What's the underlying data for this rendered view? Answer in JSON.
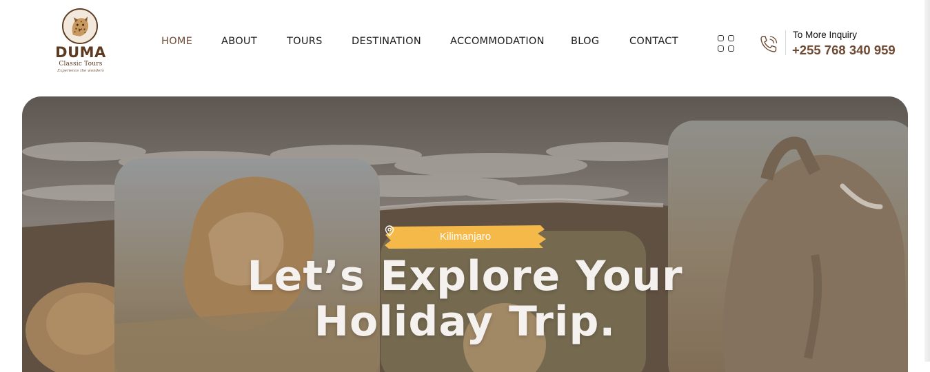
{
  "logo": {
    "name": "DUMA",
    "subtitle": "Classic Tours",
    "tagline": "Experience the wonders"
  },
  "nav": {
    "items": [
      {
        "label": "HOME",
        "active": true
      },
      {
        "label": "ABOUT"
      },
      {
        "label": "TOURS"
      },
      {
        "label": "DESTINATION"
      },
      {
        "label": "ACCOMMODATION"
      },
      {
        "label": "BLOG"
      },
      {
        "label": "CONTACT"
      }
    ]
  },
  "header": {
    "menu_icon": "grid-icon",
    "phone_icon": "phone-call-icon",
    "inquiry_label": "To More Inquiry",
    "phone_number": "+255 768 340 959"
  },
  "hero": {
    "location": "Kilimanjaro",
    "location_icon": "map-pin-icon",
    "title_line1": "Let’s Explore Your",
    "title_line2": "Holiday Trip.",
    "badge_color": "#f5b94a"
  },
  "colors": {
    "brand": "#6e4a33",
    "text": "#1a1a1a",
    "accent": "#f5b94a"
  }
}
